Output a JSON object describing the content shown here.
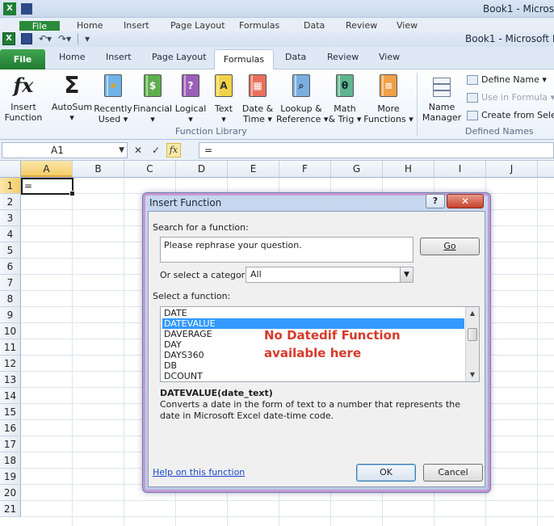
{
  "ghost_window": {
    "title": "Book1 - Microso",
    "file_label": "File",
    "tabs": [
      "Home",
      "Insert",
      "Page Layout",
      "Formulas",
      "Data",
      "Review",
      "View"
    ]
  },
  "window": {
    "title": "Book1  -  Microsoft Ex",
    "app_icon": "X"
  },
  "ribbon_tabs": {
    "file": "File",
    "home": "Home",
    "insert": "Insert",
    "page_layout": "Page Layout",
    "formulas": "Formulas",
    "data": "Data",
    "review": "Review",
    "view": "View"
  },
  "ribbon": {
    "insert_function": [
      "Insert",
      "Function"
    ],
    "autosum": [
      "AutoSum",
      "▾"
    ],
    "recently_used": [
      "Recently",
      "Used ▾"
    ],
    "financial": [
      "Financial",
      "▾"
    ],
    "logical": [
      "Logical",
      "▾"
    ],
    "text": [
      "Text",
      "▾"
    ],
    "date_time": [
      "Date &",
      "Time ▾"
    ],
    "lookup_reference": [
      "Lookup &",
      "Reference ▾"
    ],
    "math_trig": [
      "Math",
      "& Trig ▾"
    ],
    "more_functions": [
      "More",
      "Functions ▾"
    ],
    "function_library_label": "Function Library",
    "name_manager": [
      "Name",
      "Manager"
    ],
    "define_name": "Define Name ▾",
    "use_in_formula": "Use in Formula ▾",
    "create_from_selection": "Create from Selecti",
    "defined_names_label": "Defined Names"
  },
  "formula_bar": {
    "name_box": "A1",
    "cancel_glyph": "✕",
    "enter_glyph": "✓",
    "fx_glyph": "fx",
    "value": "="
  },
  "grid": {
    "columns": [
      "A",
      "B",
      "C",
      "D",
      "E",
      "F",
      "G",
      "H",
      "I",
      "J"
    ],
    "rows": [
      "1",
      "2",
      "3",
      "4",
      "5",
      "6",
      "7",
      "8",
      "9",
      "10",
      "11",
      "12",
      "13",
      "14",
      "15",
      "16",
      "17",
      "18",
      "19",
      "20",
      "21"
    ],
    "active_cell_value": "="
  },
  "dialog": {
    "title": "Insert Function",
    "help_glyph": "?",
    "close_glyph": "✕",
    "search_label": "Search for a function:",
    "search_value": "Please rephrase your question.",
    "go_label": "Go",
    "category_label": "Or select a category:",
    "category_value": "All",
    "function_label": "Select a function:",
    "functions": [
      "DATE",
      "DATEVALUE",
      "DAVERAGE",
      "DAY",
      "DAYS360",
      "DB",
      "DCOUNT"
    ],
    "selected_index": 1,
    "annotation": [
      "No Datedif Function",
      "available here"
    ],
    "signature": "DATEVALUE(date_text)",
    "description": "Converts a date in the form of text to a number that represents the date in Microsoft Excel date-time code.",
    "help_link": "Help on this function",
    "ok_label": "OK",
    "cancel_label": "Cancel"
  },
  "colors": {
    "file_tab": "#217a33",
    "annotation": "#d63a2b",
    "selection": "#3399ff",
    "link": "#1a47c9"
  }
}
